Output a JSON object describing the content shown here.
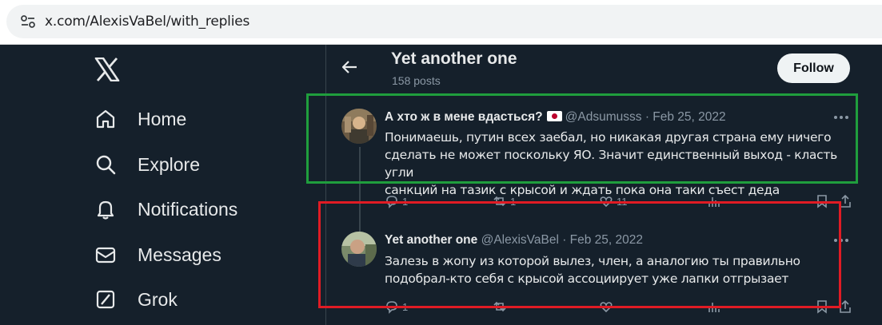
{
  "browser": {
    "url": "x.com/AlexisVaBel/with_replies"
  },
  "nav": {
    "items": [
      {
        "label": "Home",
        "icon": "home-icon"
      },
      {
        "label": "Explore",
        "icon": "search-icon"
      },
      {
        "label": "Notifications",
        "icon": "bell-icon"
      },
      {
        "label": "Messages",
        "icon": "envelope-icon"
      },
      {
        "label": "Grok",
        "icon": "grok-icon"
      }
    ]
  },
  "profile": {
    "name": "Yet another one",
    "posts": "158 posts",
    "follow_label": "Follow"
  },
  "tweets": [
    {
      "author": "А хто ж в мене вдасться?",
      "handle": "@Adsumusss",
      "sep": " · ",
      "date": "Feb 25, 2022",
      "lines": [
        "Понимаешь, путин всех заебал, но никакая другая страна ему ничего",
        "сделать не может поскольку ЯО. Значит единственный выход - класть угли",
        "санкций на тазик с крысой и ждать пока она таки съест деда"
      ],
      "counts": {
        "reply": "1",
        "retweet": "1",
        "like": "11"
      }
    },
    {
      "author": "Yet another one",
      "handle": "@AlexisVaBel",
      "sep": " · ",
      "date": "Feb 25, 2022",
      "lines": [
        "Залезь в жопу из которой вылез, член, а аналогию ты правильно",
        "подобрал-кто себя с крысой ассоциирует уже лапки отгрызает"
      ],
      "counts": {
        "reply": "1"
      }
    }
  ],
  "colors": {
    "highlight_green": "#1f9e3d",
    "highlight_red": "#e01b24",
    "background": "#15202b"
  }
}
